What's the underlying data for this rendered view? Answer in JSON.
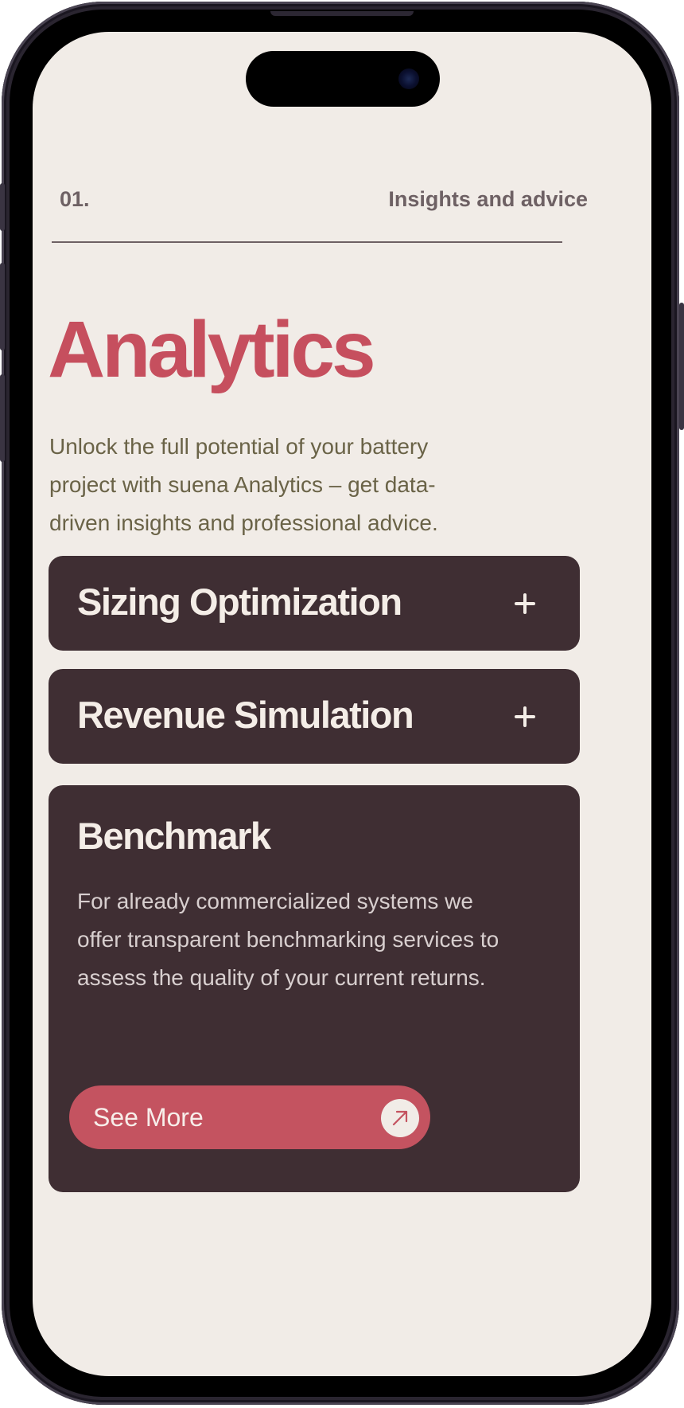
{
  "header": {
    "number": "01.",
    "label": "Insights and advice"
  },
  "hero": {
    "title": "Analytics",
    "intro": "Unlock the full potential of your battery project with suena Analytics – get data-driven insights and professional advice."
  },
  "accordion": [
    {
      "title": "Sizing Optimization",
      "expanded": false,
      "toggle_icon": "plus-icon"
    },
    {
      "title": "Revenue Simulation",
      "expanded": false,
      "toggle_icon": "plus-icon"
    },
    {
      "title": "Benchmark",
      "expanded": true,
      "description": "For already commercialized systems we offer transparent benchmarking services to assess the quality of your current returns.",
      "cta": {
        "label": "See More",
        "icon": "arrow-up-right-icon"
      }
    }
  ],
  "colors": {
    "background": "#f1ece7",
    "accent": "#c64f5e",
    "card": "#3f2e33",
    "card_text": "#f4ede7",
    "muted_text": "#6e6164",
    "body_text": "#6a6347"
  }
}
